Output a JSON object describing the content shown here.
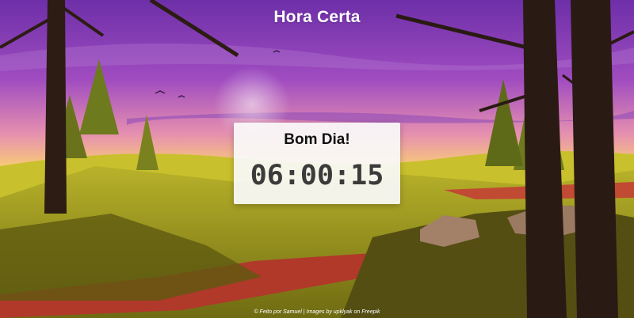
{
  "header": {
    "title": "Hora Certa"
  },
  "clock": {
    "greeting": "Bom Dia!",
    "time": "06:00:15"
  },
  "footer": {
    "credits": "© Feito por Samuel | Images by upklyak on Freepik"
  },
  "colors": {
    "sky_top": "#7d3fb8",
    "sky_horizon": "#f4e04a",
    "ground": "#8a8a1c",
    "path": "#b33a2a",
    "title_text": "#ffffff",
    "card_bg": "#fafafa"
  }
}
